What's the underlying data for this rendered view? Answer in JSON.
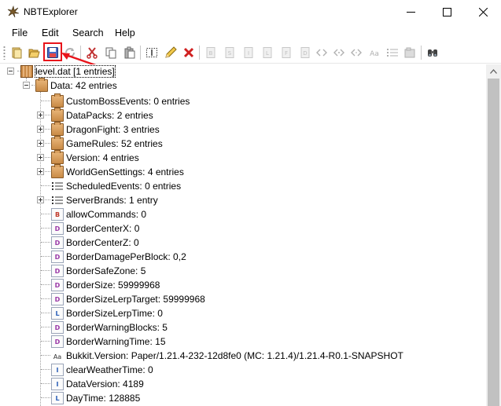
{
  "window": {
    "title": "NBTExplorer",
    "icon": "nbtexplorer-logo-icon",
    "controls": [
      "minimize-icon",
      "maximize-icon",
      "close-icon"
    ]
  },
  "menu": {
    "items": [
      "File",
      "Edit",
      "Search",
      "Help"
    ]
  },
  "toolbar": {
    "buttons": [
      "open-file-icon",
      "open-folder-icon",
      "save-icon",
      "refresh-icon",
      "cut-icon",
      "copy-icon",
      "paste-icon",
      "rename-icon",
      "edit-value-icon",
      "delete-icon",
      "add-byte-icon",
      "add-short-icon",
      "add-int-icon",
      "add-long-icon",
      "add-float-icon",
      "add-double-icon",
      "add-byte-array-icon",
      "add-int-array-icon",
      "add-long-array-icon",
      "add-string-icon",
      "add-list-icon",
      "add-compound-icon",
      "find-icon"
    ],
    "highlight_color": "#e8141b"
  },
  "tree": {
    "root": "level.dat [1 entries]",
    "data_node": "Data: 42 entries",
    "children": [
      {
        "label": "CustomBossEvents: 0 entries",
        "icon": "compound",
        "expandable": false
      },
      {
        "label": "DataPacks: 2 entries",
        "icon": "compound",
        "expandable": true
      },
      {
        "label": "DragonFight: 3 entries",
        "icon": "compound",
        "expandable": true
      },
      {
        "label": "GameRules: 52 entries",
        "icon": "compound",
        "expandable": true
      },
      {
        "label": "Version: 4 entries",
        "icon": "compound",
        "expandable": true
      },
      {
        "label": "WorldGenSettings: 4 entries",
        "icon": "compound",
        "expandable": true
      },
      {
        "label": "ScheduledEvents: 0 entries",
        "icon": "list",
        "expandable": false
      },
      {
        "label": "ServerBrands: 1 entry",
        "icon": "list",
        "expandable": true
      },
      {
        "label": "allowCommands: 0",
        "icon": "byte",
        "glyph": "B",
        "expandable": false
      },
      {
        "label": "BorderCenterX: 0",
        "icon": "double",
        "glyph": "D",
        "expandable": false
      },
      {
        "label": "BorderCenterZ: 0",
        "icon": "double",
        "glyph": "D",
        "expandable": false
      },
      {
        "label": "BorderDamagePerBlock: 0,2",
        "icon": "double",
        "glyph": "D",
        "expandable": false
      },
      {
        "label": "BorderSafeZone: 5",
        "icon": "double",
        "glyph": "D",
        "expandable": false
      },
      {
        "label": "BorderSize: 59999968",
        "icon": "double",
        "glyph": "D",
        "expandable": false
      },
      {
        "label": "BorderSizeLerpTarget: 59999968",
        "icon": "double",
        "glyph": "D",
        "expandable": false
      },
      {
        "label": "BorderSizeLerpTime: 0",
        "icon": "long",
        "glyph": "L",
        "expandable": false
      },
      {
        "label": "BorderWarningBlocks: 5",
        "icon": "double",
        "glyph": "D",
        "expandable": false
      },
      {
        "label": "BorderWarningTime: 15",
        "icon": "double",
        "glyph": "D",
        "expandable": false
      },
      {
        "label": "Bukkit.Version: Paper/1.21.4-232-12d8fe0 (MC: 1.21.4)/1.21.4-R0.1-SNAPSHOT",
        "icon": "string",
        "glyph": "AA",
        "expandable": false
      },
      {
        "label": "clearWeatherTime: 0",
        "icon": "int",
        "glyph": "I",
        "expandable": false
      },
      {
        "label": "DataVersion: 4189",
        "icon": "int",
        "glyph": "I",
        "expandable": false
      },
      {
        "label": "DayTime: 128885",
        "icon": "long",
        "glyph": "L",
        "expandable": false
      }
    ]
  },
  "colors": {
    "byte": "#c0392b",
    "double": "#9b3aa8",
    "long": "#2b5fb8",
    "int": "#2b5fb8"
  }
}
